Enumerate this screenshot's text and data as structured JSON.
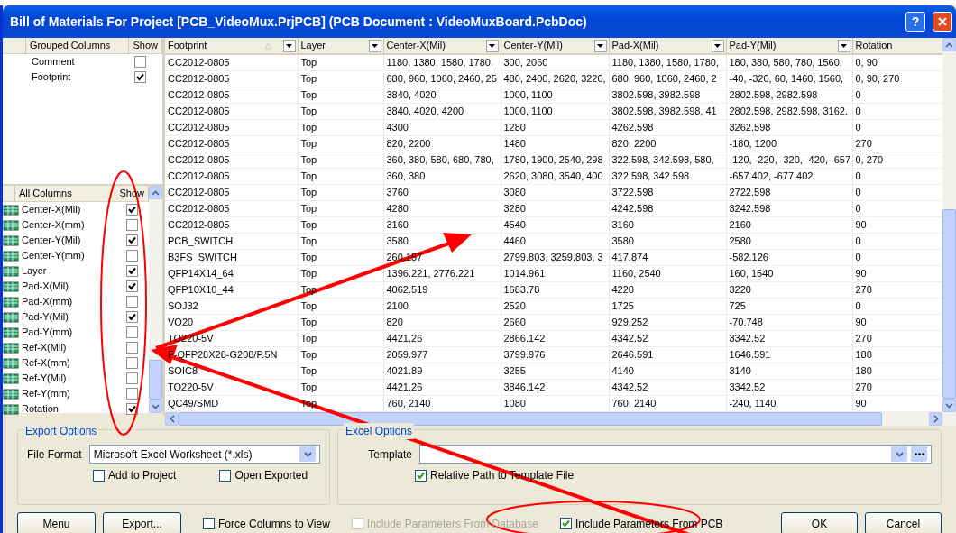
{
  "window": {
    "title": "Bill of Materials For Project [PCB_VideoMux.PrjPCB] (PCB Document : VideoMuxBoard.PcbDoc)",
    "help_label": "?"
  },
  "grouped_columns": {
    "headers": [
      "Grouped Columns",
      "Show"
    ],
    "items": [
      {
        "label": "Comment",
        "checked": false
      },
      {
        "label": "Footprint",
        "checked": true
      }
    ]
  },
  "all_columns": {
    "headers": [
      "All Columns",
      "Show"
    ],
    "items": [
      {
        "label": "Center-X(Mil)",
        "checked": true
      },
      {
        "label": "Center-X(mm)",
        "checked": false
      },
      {
        "label": "Center-Y(Mil)",
        "checked": true
      },
      {
        "label": "Center-Y(mm)",
        "checked": false
      },
      {
        "label": "Layer",
        "checked": true
      },
      {
        "label": "Pad-X(Mil)",
        "checked": true
      },
      {
        "label": "Pad-X(mm)",
        "checked": false
      },
      {
        "label": "Pad-Y(Mil)",
        "checked": true
      },
      {
        "label": "Pad-Y(mm)",
        "checked": false
      },
      {
        "label": "Ref-X(Mil)",
        "checked": false
      },
      {
        "label": "Ref-X(mm)",
        "checked": false
      },
      {
        "label": "Ref-Y(Mil)",
        "checked": false
      },
      {
        "label": "Ref-Y(mm)",
        "checked": false
      },
      {
        "label": "Rotation",
        "checked": true
      }
    ]
  },
  "grid": {
    "columns": [
      {
        "label": "Footprint",
        "sorted": true,
        "filter": true
      },
      {
        "label": "Layer",
        "sorted": false,
        "filter": true
      },
      {
        "label": "Center-X(Mil)",
        "sorted": false,
        "filter": true
      },
      {
        "label": "Center-Y(Mil)",
        "sorted": false,
        "filter": true
      },
      {
        "label": "Pad-X(Mil)",
        "sorted": false,
        "filter": true
      },
      {
        "label": "Pad-Y(Mil)",
        "sorted": false,
        "filter": true
      },
      {
        "label": "Rotation",
        "sorted": false,
        "filter": false
      }
    ],
    "rows": [
      [
        "CC2012-0805",
        "Top",
        "1180, 1380, 1580, 1780,",
        "300, 2060",
        "1180, 1380, 1580, 1780,",
        "180, 380, 580, 780, 1560,",
        "0, 90"
      ],
      [
        "CC2012-0805",
        "Top",
        "680, 960, 1060, 2460, 25",
        "480, 2400, 2620, 3220,",
        "680, 960, 1060, 2460, 2",
        "-40, -320, 60, 1460, 1560,",
        "0, 90, 270"
      ],
      [
        "CC2012-0805",
        "Top",
        "3840, 4020",
        "1000, 1100",
        "3802.598, 3982.598",
        "2802.598, 2982.598",
        "0"
      ],
      [
        "CC2012-0805",
        "Top",
        "3840, 4020, 4200",
        "1000, 1100",
        "3802.598, 3982.598, 41",
        "2802.598, 2982.598, 3162.",
        "0"
      ],
      [
        "CC2012-0805",
        "Top",
        "4300",
        "1280",
        "4262.598",
        "3262.598",
        "0"
      ],
      [
        "CC2012-0805",
        "Top",
        "820, 2200",
        "1480",
        "820, 2200",
        "-180, 1200",
        "270"
      ],
      [
        "CC2012-0805",
        "Top",
        "360, 380, 580, 680, 780,",
        "1780, 1900, 2540, 298",
        "322.598, 342.598, 580,",
        "-120, -220, -320, -420, -657",
        "0, 270"
      ],
      [
        "CC2012-0805",
        "Top",
        "360, 380",
        "2620, 3080, 3540, 400",
        "322.598, 342.598",
        "-657.402, -677.402",
        "0"
      ],
      [
        "CC2012-0805",
        "Top",
        "3760",
        "3080",
        "3722.598",
        "2722.598",
        "0"
      ],
      [
        "CC2012-0805",
        "Top",
        "4280",
        "3280",
        "4242.598",
        "3242.598",
        "0"
      ],
      [
        "CC2012-0805",
        "Top",
        "3160",
        "4540",
        "3160",
        "2160",
        "90"
      ],
      [
        "PCB_SWITCH",
        "Top",
        "3580",
        "4460",
        "3580",
        "2580",
        "0"
      ],
      [
        "B3FS_SWITCH",
        "Top",
        "260.157",
        "2799.803, 3259.803, 3",
        "417.874",
        "-582.126",
        "0"
      ],
      [
        "QFP14X14_64",
        "Top",
        "1396.221, 2776.221",
        "1014.961",
        "1160, 2540",
        "160, 1540",
        "90"
      ],
      [
        "QFP10X10_44",
        "Top",
        "4062.519",
        "1683.78",
        "4220",
        "3220",
        "270"
      ],
      [
        "SOJ32",
        "Top",
        "2100",
        "2520",
        "1725",
        "725",
        "0"
      ],
      [
        "VO20",
        "Top",
        "820",
        "2660",
        "929.252",
        "-70.748",
        "90"
      ],
      [
        "TO220-5V",
        "Top",
        "4421.26",
        "2866.142",
        "4342.52",
        "3342.52",
        "270"
      ],
      [
        "F-QFP28X28-G208/P.5N",
        "Top",
        "2059.977",
        "3799.976",
        "2646.591",
        "1646.591",
        "180"
      ],
      [
        "SOIC8",
        "Top",
        "4021.89",
        "3255",
        "4140",
        "3140",
        "180"
      ],
      [
        "TO220-5V",
        "Top",
        "4421.26",
        "3846.142",
        "4342.52",
        "3342.52",
        "270"
      ],
      [
        "QC49/SMD",
        "Top",
        "760, 2140",
        "1080",
        "760, 2140",
        "-240, 1140",
        "90"
      ]
    ]
  },
  "export_options": {
    "title": "Export Options",
    "file_format_label": "File Format",
    "file_format": "Microsoft Excel Worksheet (*.xls)",
    "checkboxes": [
      {
        "label": "Add to Project",
        "checked": false
      },
      {
        "label": "Open Exported",
        "checked": false
      }
    ]
  },
  "excel_options": {
    "title": "Excel Options",
    "template_label": "Template",
    "checkboxes": [
      {
        "label": "Relative Path to Template File",
        "checked": true
      }
    ]
  },
  "footer": {
    "buttons_left": [
      "Menu",
      "Export..."
    ],
    "checkboxes": [
      {
        "label": "Force Columns to View",
        "checked": false,
        "disabled": false
      },
      {
        "label": "Include Parameters From Database",
        "checked": false,
        "disabled": true
      },
      {
        "label": "Include Parameters From PCB",
        "checked": true,
        "disabled": false
      }
    ],
    "buttons_right": [
      "OK",
      "Cancel"
    ]
  }
}
